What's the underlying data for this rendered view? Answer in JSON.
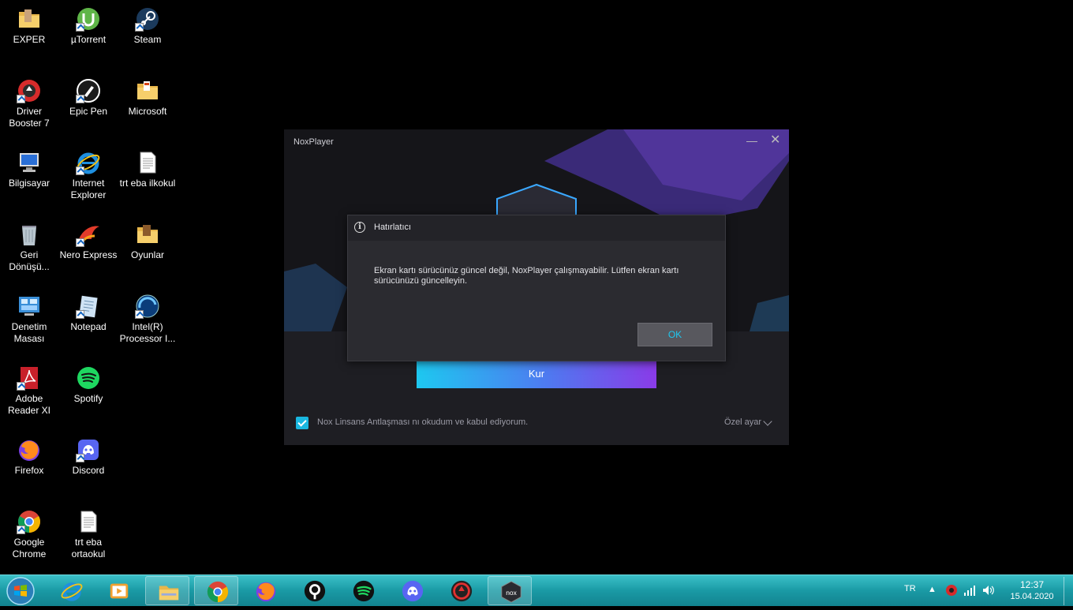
{
  "desktop_icons": [
    {
      "label": "EXPER",
      "icon": "folder-icon"
    },
    {
      "label": "µTorrent",
      "icon": "utorrent-icon"
    },
    {
      "label": "Steam",
      "icon": "steam-icon"
    },
    {
      "label": "Driver Booster 7",
      "icon": "driver-booster-icon"
    },
    {
      "label": "Epic Pen",
      "icon": "epic-pen-icon"
    },
    {
      "label": "Microsoft",
      "icon": "folder-icon"
    },
    {
      "label": "Bilgisayar",
      "icon": "computer-icon"
    },
    {
      "label": "Internet Explorer",
      "icon": "internet-explorer-icon"
    },
    {
      "label": "trt eba ilkokul",
      "icon": "text-file-icon"
    },
    {
      "label": "Geri Dönüşü...",
      "icon": "recycle-bin-icon"
    },
    {
      "label": "Nero Express",
      "icon": "nero-icon"
    },
    {
      "label": "Oyunlar",
      "icon": "folder-icon"
    },
    {
      "label": "Denetim Masası",
      "icon": "control-panel-icon"
    },
    {
      "label": "Notepad",
      "icon": "notepad-icon"
    },
    {
      "label": "Intel(R) Processor I...",
      "icon": "intel-icon"
    },
    {
      "label": "Adobe Reader XI",
      "icon": "adobe-reader-icon"
    },
    {
      "label": "Spotify",
      "icon": "spotify-icon"
    },
    {
      "label": "Firefox",
      "icon": "firefox-icon"
    },
    {
      "label": "Discord",
      "icon": "discord-icon"
    },
    {
      "label": "Google Chrome",
      "icon": "chrome-icon"
    },
    {
      "label": "trt eba ortaokul",
      "icon": "text-file-icon"
    }
  ],
  "nox_window": {
    "title": "NoxPlayer",
    "minimize": "—",
    "close": "✕",
    "install_button": "Kur",
    "license_text": "Nox Linsans Antlaşması nı okudum ve kabul ediyorum.",
    "custom_settings": "Özel ayar"
  },
  "dialog": {
    "title": "Hatırlatıcı",
    "info_glyph": "i",
    "message": "Ekran kartı sürücünüz güncel değil, NoxPlayer çalışmayabilir. Lütfen ekran kartı sürücünüzü güncelleyin.",
    "ok_button": "OK"
  },
  "taskbar": {
    "apps": [
      "internet-explorer-icon",
      "media-player-icon",
      "file-explorer-icon",
      "chrome-icon",
      "firefox-icon",
      "epic-pen-icon",
      "spotify-icon",
      "discord-icon",
      "driver-booster-icon",
      "nox-icon"
    ],
    "language": "TR",
    "time": "12:37",
    "date": "15.04.2020"
  },
  "colors": {
    "accent": "#1ec8f0",
    "taskbar": "#1a9aa5",
    "gradient_end": "#8a3be8"
  }
}
